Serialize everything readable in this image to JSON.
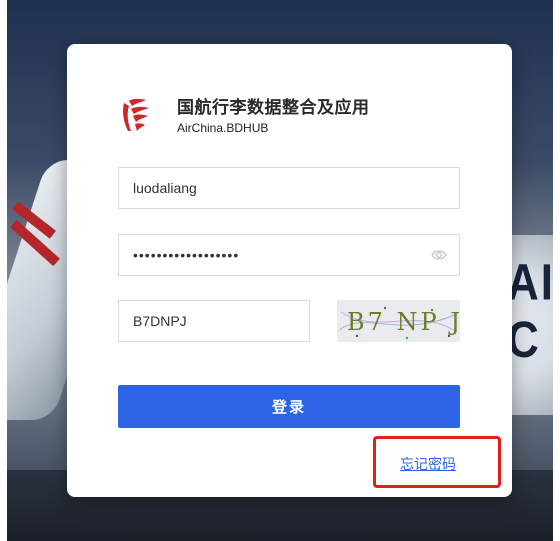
{
  "app": {
    "title": "国航行李数据整合及应用",
    "subtitle": "AirChina.BDHUB"
  },
  "login_form": {
    "username_value": "luodaliang",
    "password_value": "••••••••••••••••••",
    "captcha_value": "B7DNPJ",
    "captcha_image_text": "B7 NP J",
    "submit_label": "登录",
    "forgot_password_label": "忘记密码"
  },
  "background": {
    "plane_livery_text": "AIR C"
  },
  "colors": {
    "primary": "#2d64e6",
    "brand_red": "#d1262b",
    "highlight_box": "#e0201b"
  },
  "icons": {
    "logo": "air-china-phoenix-icon",
    "password_toggle": "eye-icon"
  }
}
